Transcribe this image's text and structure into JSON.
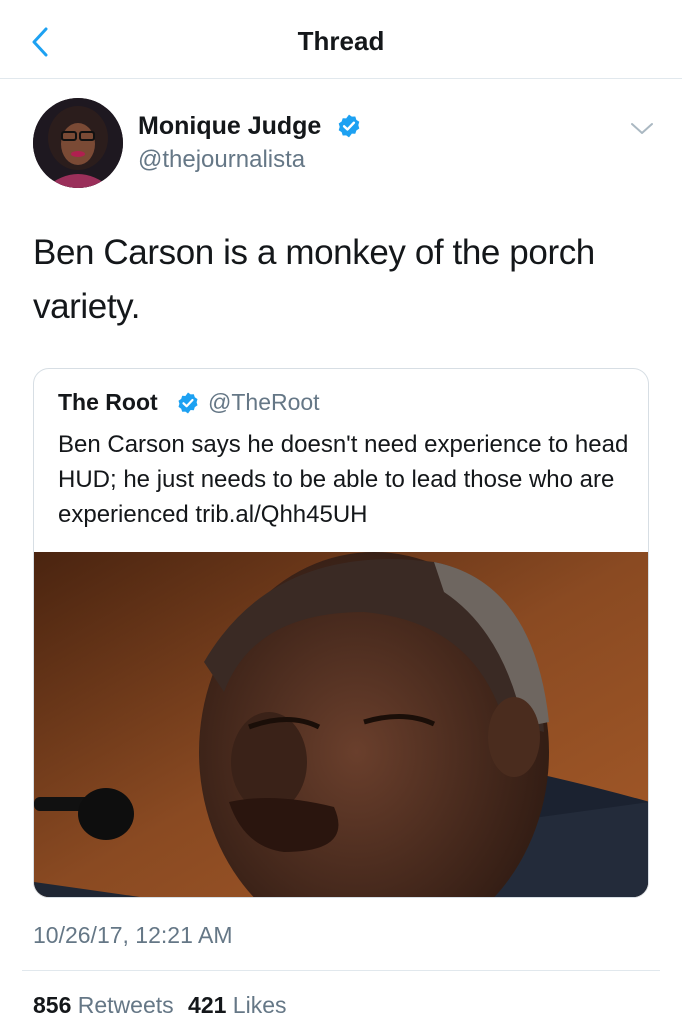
{
  "header": {
    "title": "Thread",
    "back_icon": "chevron-left-icon"
  },
  "colors": {
    "accent": "#1da1f2",
    "secondary_text": "#657786",
    "divider": "#e1e8ed"
  },
  "tweet": {
    "author_name": "Monique Judge",
    "author_handle": "@thejournalista",
    "verified": true,
    "text": "Ben Carson is a monkey of the porch variety.",
    "timestamp": "10/26/17, 12:21 AM",
    "retweets_count": "856",
    "retweets_label": "Retweets",
    "likes_count": "421",
    "likes_label": "Likes"
  },
  "quoted_tweet": {
    "author_name": "The Root",
    "author_handle": "@TheRoot",
    "verified": true,
    "text": "Ben Carson says he doesn't need experience to head HUD; he just needs to be able to lead those who are experienced trib.al/Qhh45UH",
    "media": "photo-of-man-speaking-at-microphone"
  }
}
